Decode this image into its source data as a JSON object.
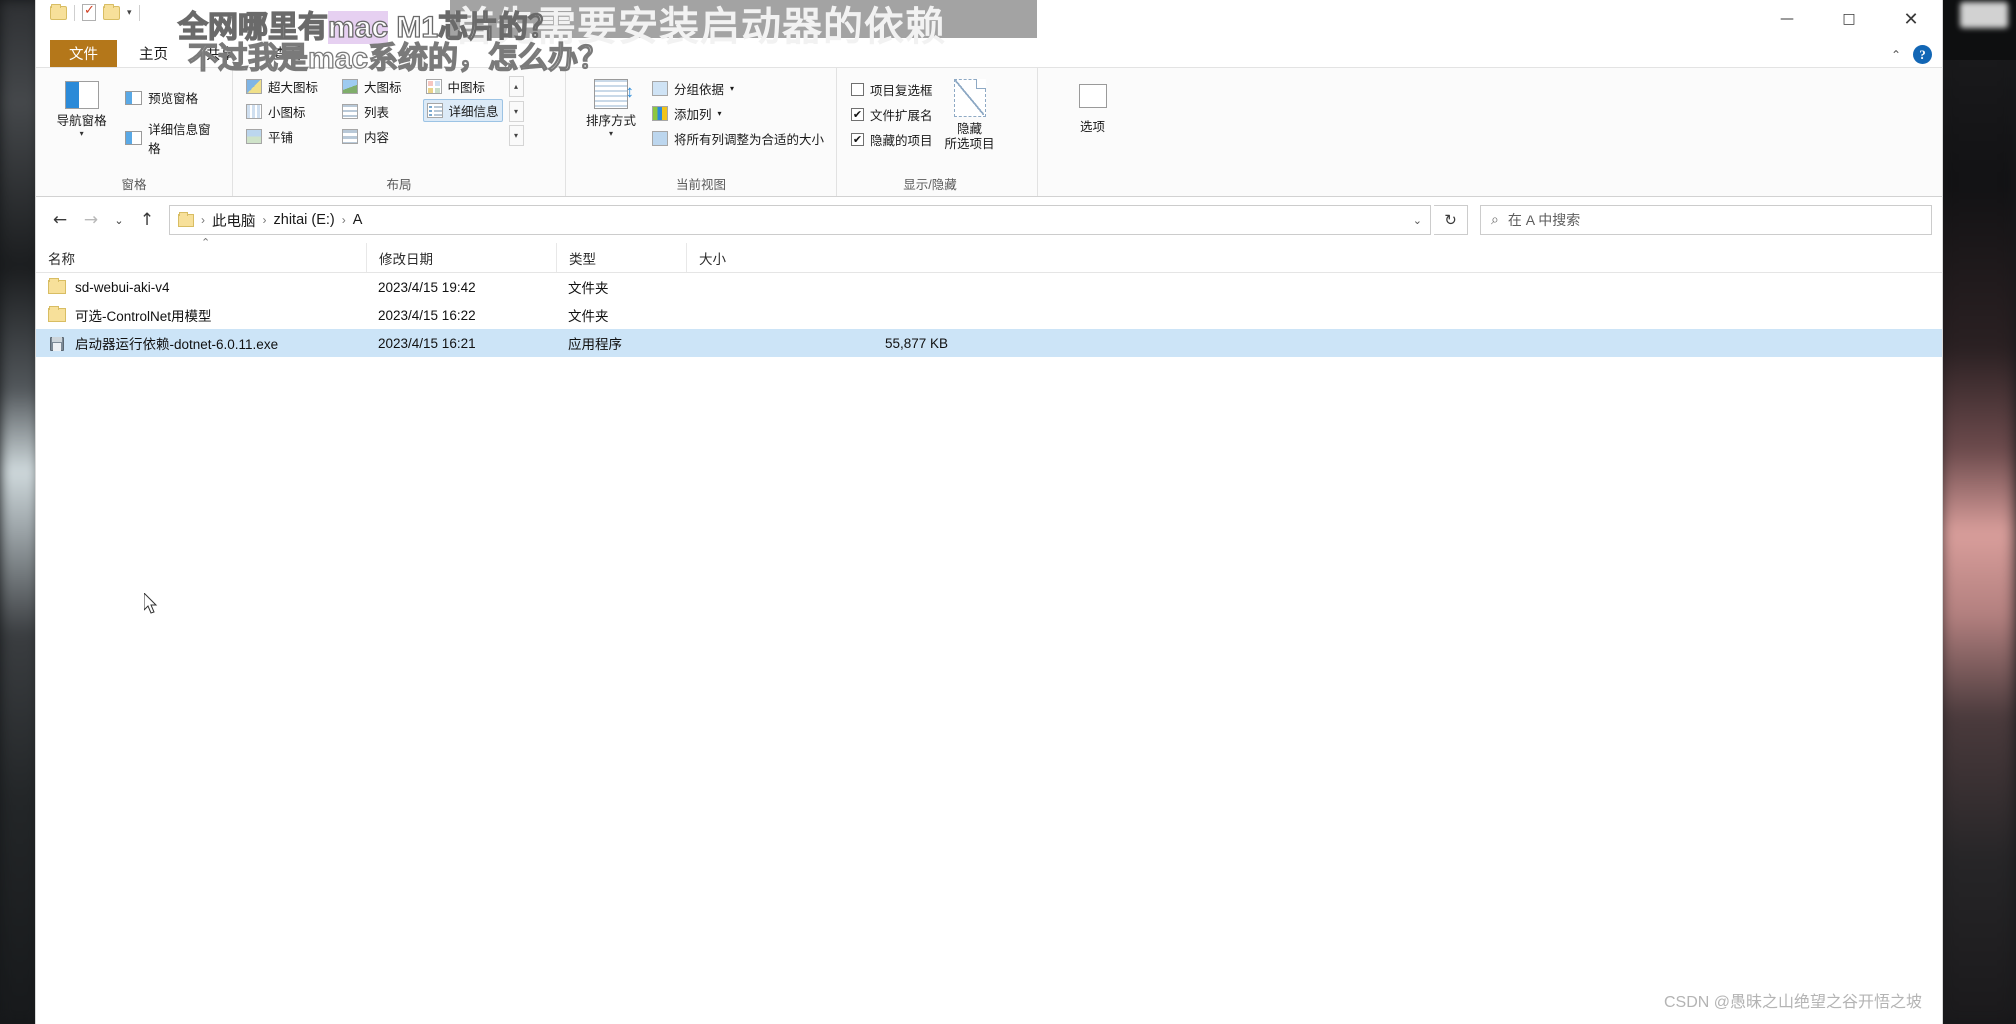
{
  "window": {
    "controls": {
      "minimize": "—",
      "maximize": "□",
      "close": "✕"
    },
    "help": "?",
    "collapse_ribbon": "⌃"
  },
  "quick_access": {
    "items": [
      {
        "name": "quick-access-folder-icon",
        "label": ""
      },
      {
        "name": "quick-access-properties-icon",
        "label": ""
      },
      {
        "name": "quick-access-new-folder-icon",
        "label": ""
      }
    ],
    "dropdown": "▾"
  },
  "tabs": [
    {
      "id": "file",
      "label": "文件"
    },
    {
      "id": "home",
      "label": "主页"
    },
    {
      "id": "share",
      "label": "共享"
    },
    {
      "id": "view",
      "label": "查看"
    }
  ],
  "ribbon": {
    "groups": [
      {
        "id": "panes",
        "label": "窗格"
      },
      {
        "id": "layout",
        "label": "布局"
      },
      {
        "id": "current_view",
        "label": "当前视图"
      },
      {
        "id": "show_hide",
        "label": "显示/隐藏"
      }
    ],
    "panes": {
      "nav_pane": "导航窗格",
      "nav_pane_arrow": "▾",
      "preview_pane": "预览窗格",
      "details_pane": "详细信息窗格"
    },
    "layout": {
      "items": [
        {
          "label": "超大图标",
          "selected": false
        },
        {
          "label": "大图标",
          "selected": false
        },
        {
          "label": "中图标",
          "selected": false
        },
        {
          "label": "小图标",
          "selected": false
        },
        {
          "label": "列表",
          "selected": false
        },
        {
          "label": "详细信息",
          "selected": true
        },
        {
          "label": "平铺",
          "selected": false
        },
        {
          "label": "内容",
          "selected": false
        }
      ],
      "scroll_up": "▴",
      "scroll_down": "▾",
      "expand": "▾"
    },
    "current_view": {
      "sort_by": "排序方式",
      "sort_by_arrow": "▾",
      "group_by": "分组依据",
      "group_by_arrow": "▾",
      "add_columns": "添加列",
      "add_columns_arrow": "▾",
      "size_all_columns": "将所有列调整为合适的大小"
    },
    "show_hide": {
      "item_checkboxes": {
        "label": "项目复选框",
        "checked": false
      },
      "file_extensions": {
        "label": "文件扩展名",
        "checked": true
      },
      "hidden_items": {
        "label": "隐藏的项目",
        "checked": true
      },
      "hide_selected_line1": "隐藏",
      "hide_selected_line2": "所选项目",
      "options": "选项"
    }
  },
  "address_bar": {
    "back": "←",
    "forward": "→",
    "recent": "⌄",
    "up": "↑",
    "breadcrumbs": [
      "此电脑",
      "zhitai (E:)",
      "A"
    ],
    "separator": "›",
    "dropdown": "⌄",
    "refresh": "↻",
    "search_placeholder": "在 A 中搜索",
    "search_value": "",
    "search_icon": "⌕"
  },
  "file_list": {
    "columns": [
      {
        "key": "name",
        "label": "名称",
        "sorted": true,
        "sort_mark": "⌃"
      },
      {
        "key": "date",
        "label": "修改日期"
      },
      {
        "key": "type",
        "label": "类型"
      },
      {
        "key": "size",
        "label": "大小"
      }
    ],
    "rows": [
      {
        "icon": "folder",
        "name": "sd-webui-aki-v4",
        "date": "2023/4/15 19:42",
        "type": "文件夹",
        "size": "",
        "selected": false
      },
      {
        "icon": "folder",
        "name": "可选-ControlNet用模型",
        "date": "2023/4/15 16:22",
        "type": "文件夹",
        "size": "",
        "selected": false
      },
      {
        "icon": "msi",
        "name": "启动器运行依赖-dotnet-6.0.11.exe",
        "date": "2023/4/15 16:21",
        "type": "应用程序",
        "size": "55,877 KB",
        "selected": true
      }
    ]
  },
  "overlay": {
    "banner_text": "首先需要安装启动器的依赖",
    "subtitle_line1_a": "全网哪里有",
    "subtitle_line1_b": "mac",
    "subtitle_line1_c": " M1芯片的？",
    "subtitle_line2": "不过我是mac系统的，怎么办？"
  },
  "watermark": "CSDN @愚昧之山绝望之谷开悟之坡",
  "colors": {
    "file_tab": "#b4771a",
    "selection": "#cce4f7",
    "accent": "#2b8ad8",
    "help_blue": "#1266b5"
  }
}
